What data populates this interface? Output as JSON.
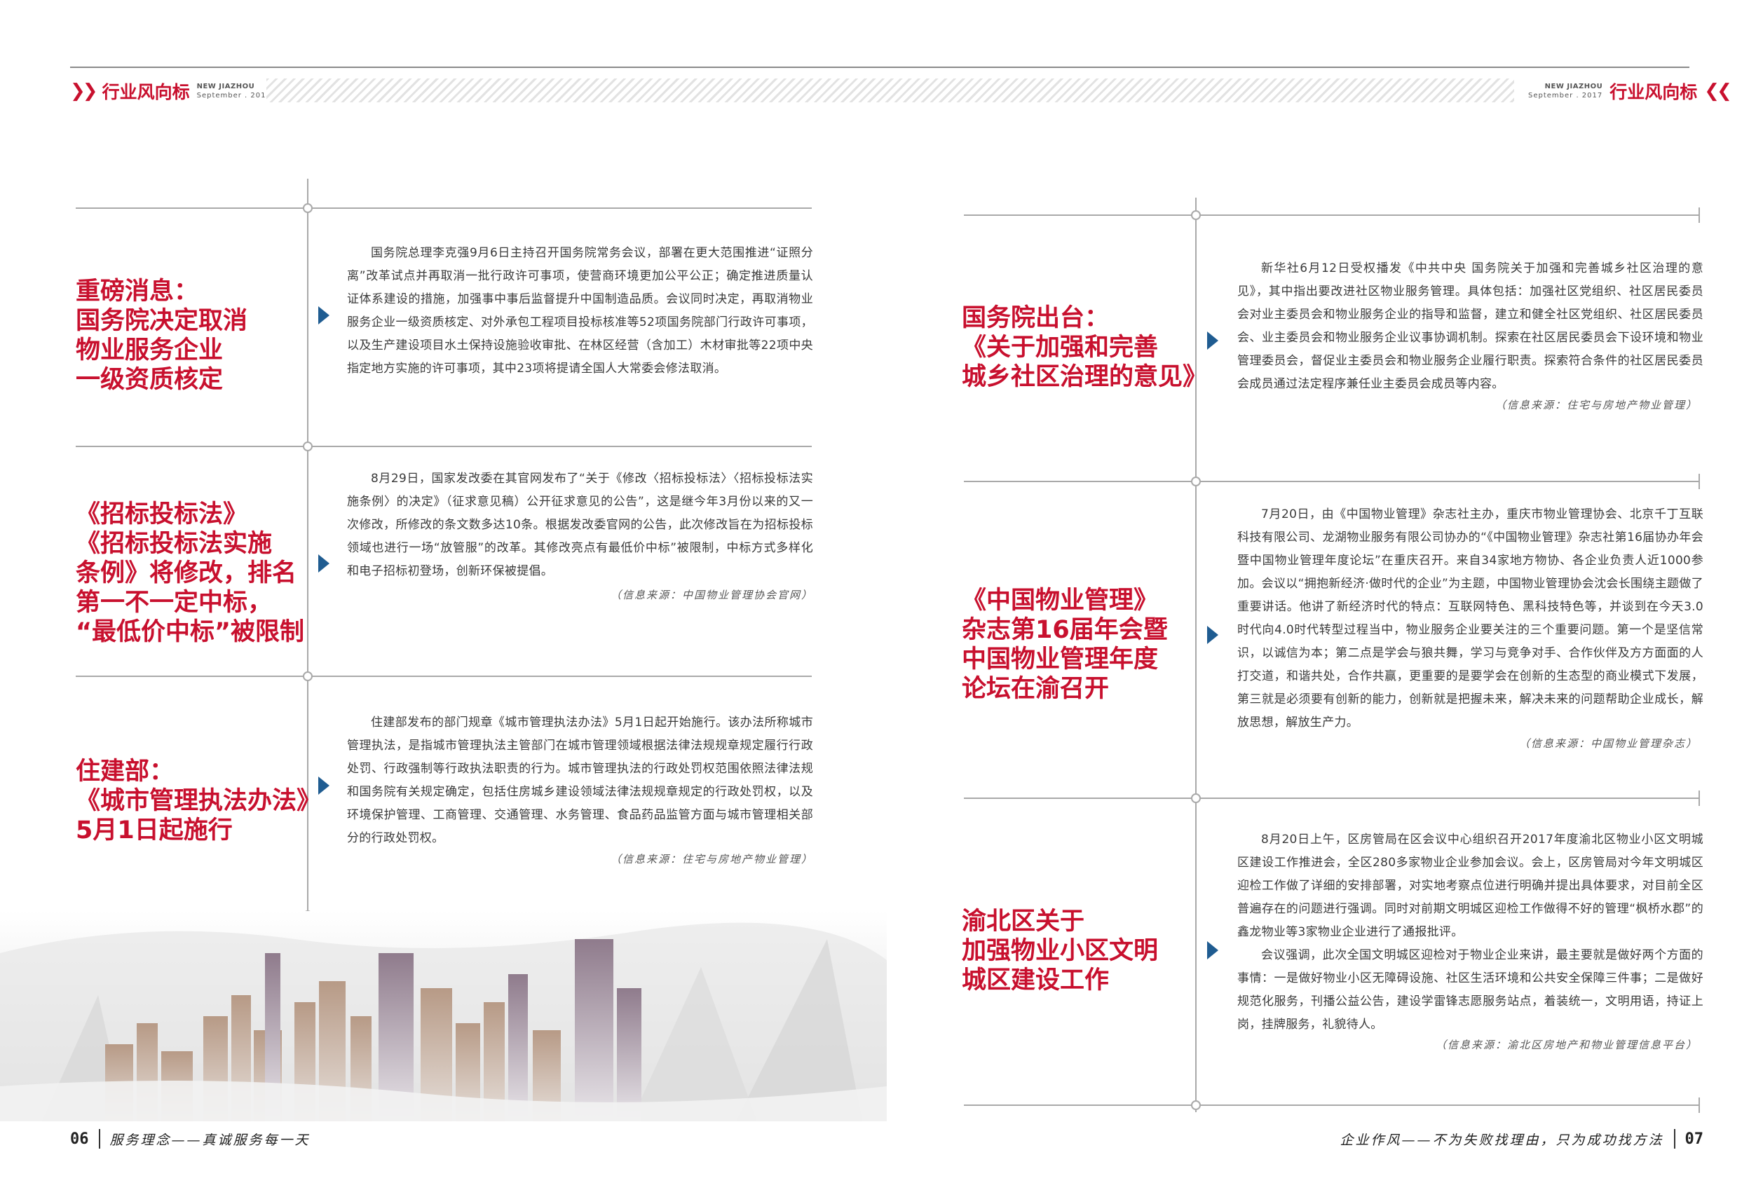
{
  "header": {
    "left": {
      "title": "行业风向标",
      "en": "NEW JIAZHOU",
      "date": "September . 2017"
    },
    "right": {
      "title": "行业风向标",
      "en": "NEW JIAZHOU",
      "date": "September . 2017"
    }
  },
  "left_page": {
    "items": [
      {
        "headline": [
          "重磅消息：",
          "国务院决定取消",
          "物业服务企业",
          "一级资质核定"
        ],
        "body": "国务院总理李克强9月6日主持召开国务院常务会议，部署在更大范围推进“证照分离”改革试点并再取消一批行政许可事项，使营商环境更加公平公正；确定推进质量认证体系建设的措施，加强事中事后监督提升中国制造品质。会议同时决定，再取消物业服务企业一级资质核定、对外承包工程项目投标核准等52项国务院部门行政许可事项，以及生产建设项目水土保持设施验收审批、在林区经营（含加工）木材审批等22项中央指定地方实施的许可事项，其中23项将提请全国人大常委会修法取消。",
        "source": ""
      },
      {
        "headline": [
          "《招标投标法》",
          "《招标投标法实施",
          "条例》将修改，排名",
          "第一不一定中标，",
          "“最低价中标”被限制"
        ],
        "body": "8月29日，国家发改委在其官网发布了“关于《修改〈招标投标法〉〈招标投标法实施条例〉的决定》（征求意见稿）公开征求意见的公告”，这是继今年3月份以来的又一次修改，所修改的条文数多达10条。根据发改委官网的公告，此次修改旨在为招标投标领域也进行一场“放管服”的改革。其修改亮点有最低价中标”被限制，中标方式多样化和电子招标初登场，创新环保被提倡。",
        "source": "（信息来源：中国物业管理协会官网）"
      },
      {
        "headline": [
          "住建部：",
          "《城市管理执法办法》",
          "5月1日起施行"
        ],
        "body": "住建部发布的部门规章《城市管理执法办法》5月1日起开始施行。该办法所称城市管理执法，是指城市管理执法主管部门在城市管理领域根据法律法规规章规定履行行政处罚、行政强制等行政执法职责的行为。城市管理执法的行政处罚权范围依照法律法规和国务院有关规定确定，包括住房城乡建设领域法律法规规章规定的行政处罚权，以及环境保护管理、工商管理、交通管理、水务管理、食品药品监管方面与城市管理相关部分的行政处罚权。",
        "source": "（信息来源：住宅与房地产物业管理）"
      }
    ],
    "footer": {
      "page": "06",
      "text": "服务理念——真诚服务每一天"
    }
  },
  "right_page": {
    "items": [
      {
        "headline": [
          "国务院出台：",
          "《关于加强和完善",
          "城乡社区治理的意见》"
        ],
        "body": "新华社6月12日受权播发《中共中央 国务院关于加强和完善城乡社区治理的意见》，其中指出要改进社区物业服务管理。具体包括：加强社区党组织、社区居民委员会对业主委员会和物业服务企业的指导和监督，建立和健全社区党组织、社区居民委员会、业主委员会和物业服务企业议事协调机制。探索在社区居民委员会下设环境和物业管理委员会，督促业主委员会和物业服务企业履行职责。探索符合条件的社区居民委员会成员通过法定程序兼任业主委员会成员等内容。",
        "source": "（信息来源：住宅与房地产物业管理）"
      },
      {
        "headline": [
          "《中国物业管理》",
          "杂志第16届年会暨",
          "中国物业管理年度",
          "论坛在渝召开"
        ],
        "body": "7月20日，由《中国物业管理》杂志社主办，重庆市物业管理协会、北京千丁互联科技有限公司、龙湖物业服务有限公司协办的“《中国物业管理》杂志社第16届协办年会暨中国物业管理年度论坛”在重庆召开。来自34家地方物协、各企业负责人近1000参加。会议以“拥抱新经济·做时代的企业”为主题，中国物业管理协会沈会长围绕主题做了重要讲话。他讲了新经济时代的特点：互联网特色、黑科技特色等，并谈到在今天3.0时代向4.0时代转型过程当中，物业服务企业要关注的三个重要问题。第一个是坚信常识，以诚信为本；第二点是学会与狼共舞，学习与竞争对手、合作伙伴及方方面面的人打交道，和谐共处，合作共赢，更重要的是要学会在创新的生态型的商业模式下发展，第三就是必须要有创新的能力，创新就是把握未来，解决未来的问题帮助企业成长，解放思想，解放生产力。",
        "source": "（信息来源：中国物业管理杂志）"
      },
      {
        "headline": [
          "渝北区关于",
          "加强物业小区文明",
          "城区建设工作"
        ],
        "body": "8月20日上午，区房管局在区会议中心组织召开2017年度渝北区物业小区文明城区建设工作推进会，全区280多家物业企业参加会议。会上，区房管局对今年文明城区迎检工作做了详细的安排部署，对实地考察点位进行明确并提出具体要求，对目前全区普遍存在的问题进行强调。同时对前期文明城区迎检工作做得不好的管理“枫桥水郡”的鑫龙物业等3家物业企业进行了通报批评。",
        "body2": "会议强调，此次全国文明城区迎检对于物业企业来讲，最主要就是做好两个方面的事情：一是做好物业小区无障碍设施、社区生活环境和公共安全保障三件事；二是做好规范化服务，刊播公益公告，建设学雷锋志愿服务站点，着装统一，文明用语，持证上岗，挂牌服务，礼貌待人。",
        "source": "（信息来源：渝北区房地产和物业管理信息平台）"
      }
    ],
    "footer": {
      "page": "07",
      "text": "企业作风——不为失败找理由，只为成功找方法"
    }
  },
  "colors": {
    "accent_red": "#c8102e",
    "arrow_blue": "#1f5c91",
    "line_gray": "#a9a9a9"
  }
}
